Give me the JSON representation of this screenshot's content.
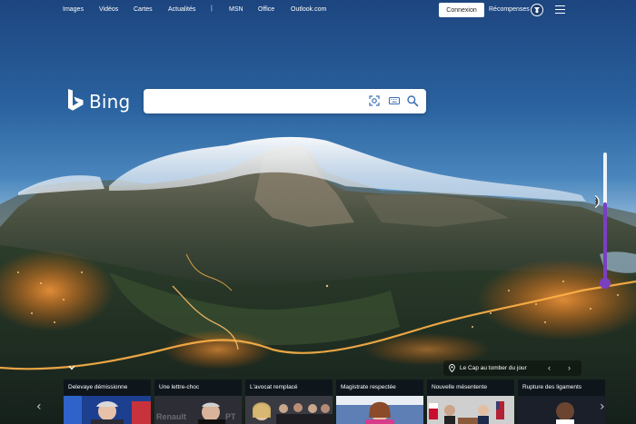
{
  "topnav": {
    "links": [
      "Images",
      "Vidéos",
      "Cartes",
      "Actualités",
      "MSN",
      "Office",
      "Outlook.com"
    ],
    "separator": "|",
    "signin_label": "Connexion",
    "rewards_label": "Récompenses"
  },
  "logo": {
    "text": "Bing"
  },
  "search": {
    "value": "",
    "placeholder": ""
  },
  "caption": {
    "text": "Le Cap au tomber du jour"
  },
  "news": [
    {
      "title": "Delevaye démissionne"
    },
    {
      "title": "Une lettre-choc"
    },
    {
      "title": "L'avocat remplacé"
    },
    {
      "title": "Magistrate respectée"
    },
    {
      "title": "Nouvelle mésentente"
    },
    {
      "title": "Rupture des ligaments"
    }
  ],
  "news_thumb_text": {
    "card2": "Renault",
    "card2b": "PT"
  },
  "colors": {
    "accent": "#7b3fc2",
    "sky_top": "#1f4a86",
    "signin_bg": "#ffffff"
  },
  "icons": {
    "logo": "bing-b-logo",
    "visual_search": "camera-scan-icon",
    "keyboard": "keyboard-icon",
    "search": "search-icon",
    "rewards": "rewards-medal-icon",
    "menu": "hamburger-menu-icon",
    "location": "location-pin-icon"
  }
}
